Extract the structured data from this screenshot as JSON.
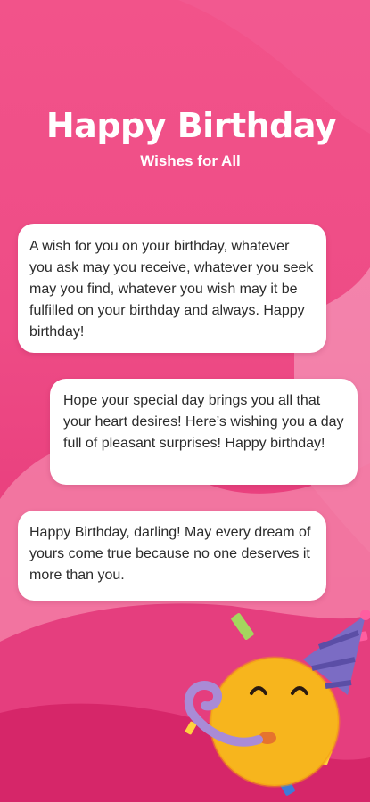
{
  "header": {
    "title": "Happy Birthday",
    "subtitle": "Wishes for All"
  },
  "wishes": [
    {
      "text": "A wish for you on your birthday, whatever you ask may you receive, whatever you seek may you find, whatever you wish may it be fulfilled on your birthday and always. Happy birthday!"
    },
    {
      "text": "Hope your special day brings you all that your heart desires! Here’s wishing you a day full of pleasant surprises! Happy birthday!"
    },
    {
      "text": "Happy Birthday, darling! May every dream of yours come true because no one deserves it more than you."
    }
  ],
  "colors": {
    "background": "#ee4c86",
    "wave_light": "#f37ba4",
    "card": "#ffffff",
    "text": "#2b2b2b",
    "emoji_face": "#f7b51d",
    "party_hat": "#7b6cc4"
  },
  "icons": {
    "emoji": "party-face-icon"
  }
}
